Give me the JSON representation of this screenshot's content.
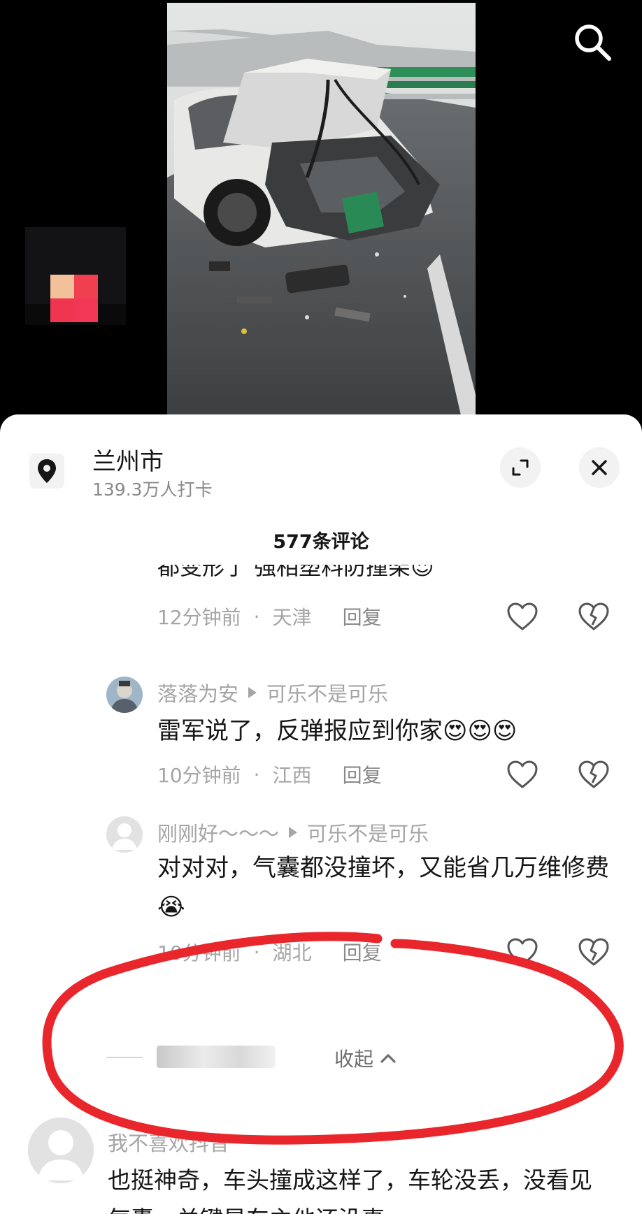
{
  "location": {
    "name": "兰州市",
    "checkins": "139.3万人打卡"
  },
  "comments_header": {
    "count_label": "577条评论"
  },
  "partial_comment": {
    "text_cut": "都变形了 强相塑料防撞架",
    "time": "12分钟前",
    "region": "天津",
    "reply_label": "回复"
  },
  "replies": [
    {
      "user": "落落为安",
      "reply_to": "可乐不是可乐",
      "text": "雷军说了，反弹报应到你家",
      "emoji": "😍😍😍",
      "time": "10分钟前",
      "region": "江西",
      "reply_label": "回复"
    },
    {
      "user": "刚刚好～～～",
      "reply_to": "可乐不是可乐",
      "text": "对对对，气囊都没撞坏，又能省几万维修费",
      "emoji": "😭",
      "time": "10分钟前",
      "region": "湖北",
      "reply_label": "回复"
    }
  ],
  "collapse": {
    "label": "收起"
  },
  "top_comment": {
    "user": "我不喜欢抖音",
    "text": "也挺神奇，车头撞成这样了，车轮没丢，没看见气囊，关键是车主他还没事。"
  },
  "colors": {
    "annotation_red": "#e8262b",
    "muted_text": "#a5a5a5",
    "primary_text": "#161616"
  },
  "icons": [
    "search-icon",
    "location-pin-icon",
    "expand-icon",
    "close-icon",
    "heart-icon",
    "broken-heart-icon",
    "chevron-up-icon"
  ]
}
